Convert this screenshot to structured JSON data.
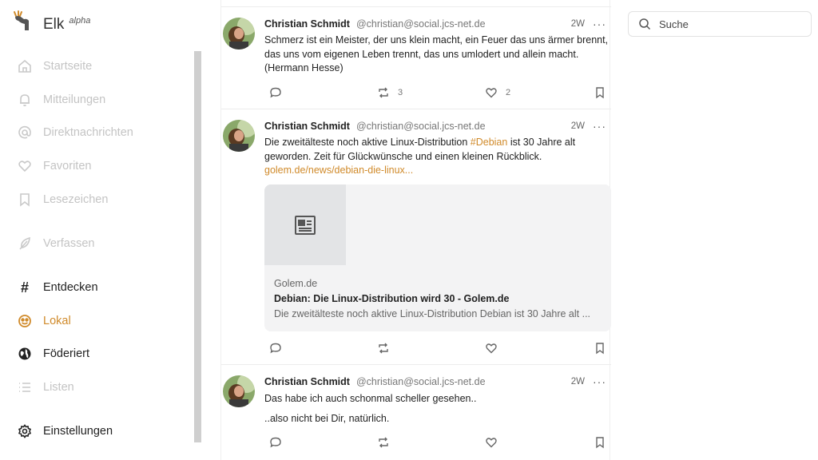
{
  "app": {
    "name": "Elk",
    "tag": "alpha"
  },
  "nav": {
    "home": "Startseite",
    "notifications": "Mitteilungen",
    "messages": "Direktnachrichten",
    "favorites": "Favoriten",
    "bookmarks": "Lesezeichen",
    "compose": "Verfassen",
    "explore": "Entdecken",
    "local": "Lokal",
    "federated": "Föderiert",
    "lists": "Listen",
    "settings": "Einstellungen"
  },
  "search": {
    "placeholder": "Suche"
  },
  "colors": {
    "accent": "#d08a2a",
    "dim": "#c4c4c4"
  },
  "posts": [
    {
      "author": "Christian Schmidt",
      "handle": "@christian@social.jcs-net.de",
      "time": "2W",
      "more": "···",
      "text": "Schmerz ist ein Meister, der uns klein macht, ein Feuer das uns ärmer brennt, das uns vom eigenen Leben trennt, das uns umlodert und allein macht. (Hermann Hesse)",
      "boosts": "3",
      "favs": "2"
    },
    {
      "author": "Christian Schmidt",
      "handle": "@christian@social.jcs-net.de",
      "time": "2W",
      "more": "···",
      "text_before": "Die zweitälteste noch aktive Linux-Distribution ",
      "hashtag": "#Debian",
      "text_after": " ist 30 Jahre alt geworden. Zeit für Glückwünsche und einen kleinen Rückblick.",
      "link": "golem.de/news/debian-die-linux...",
      "card": {
        "site": "Golem.de",
        "title": "Debian: Die Linux-Distribution wird 30 - Golem.de",
        "description": "Die zweitälteste noch aktive Linux-Distribution Debian ist 30 Jahre alt ..."
      }
    },
    {
      "author": "Christian Schmidt",
      "handle": "@christian@social.jcs-net.de",
      "time": "2W",
      "more": "···",
      "line1": "Das habe ich auch schonmal scheller gesehen..",
      "line2": "..also nicht bei Dir, natürlich."
    }
  ]
}
